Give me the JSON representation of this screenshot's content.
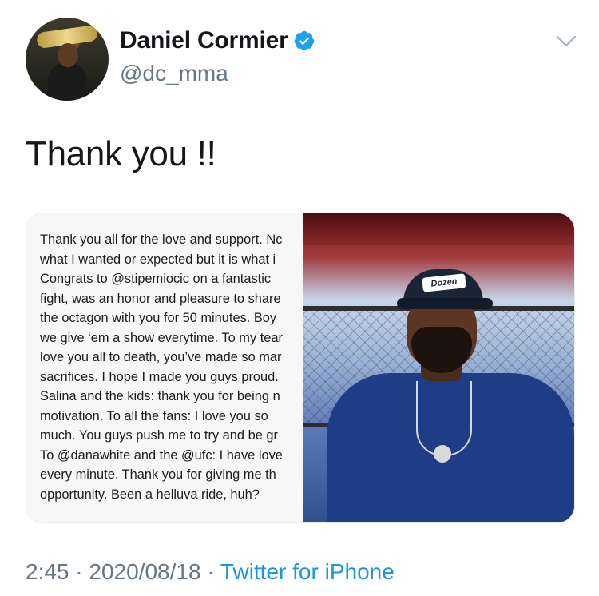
{
  "author": {
    "display_name": "Daniel Cormier",
    "handle": "@dc_mma",
    "verified_icon": "verified-badge-icon",
    "avatar_icon": "avatar"
  },
  "menu": {
    "icon": "chevron-down-icon"
  },
  "tweet": {
    "text": "Thank you !!",
    "image_note_lines": [
      "Thank you all for the love and support. Nc",
      "what I wanted or expected but it is what i",
      "Congrats to @stipemiocic on a fantastic",
      "fight, was an honor and pleasure to share",
      "the octagon with you for 50 minutes. Boy",
      "we give ‘em a show everytime. To my tear",
      "love you all to death, you’ve made so mar",
      "sacrifices. I hope I made you guys proud.",
      "Salina and the kids: thank you for being n",
      "motivation. To all the fans: I love you so",
      "much. You guys push me to try and be gr",
      "To @danawhite and the @ufc: I have love",
      "every minute. Thank you for giving me th",
      "opportunity. Been a helluva ride, huh?"
    ],
    "photo_cap_text": "Dozen"
  },
  "meta": {
    "time": "2:45",
    "sep1": " · ",
    "date": "2020/08/18",
    "sep2": " · ",
    "source": "Twitter for iPhone"
  },
  "colors": {
    "text_primary": "#14171a",
    "text_secondary": "#657786",
    "link": "#1b95e0",
    "verified": "#1da1f2"
  }
}
